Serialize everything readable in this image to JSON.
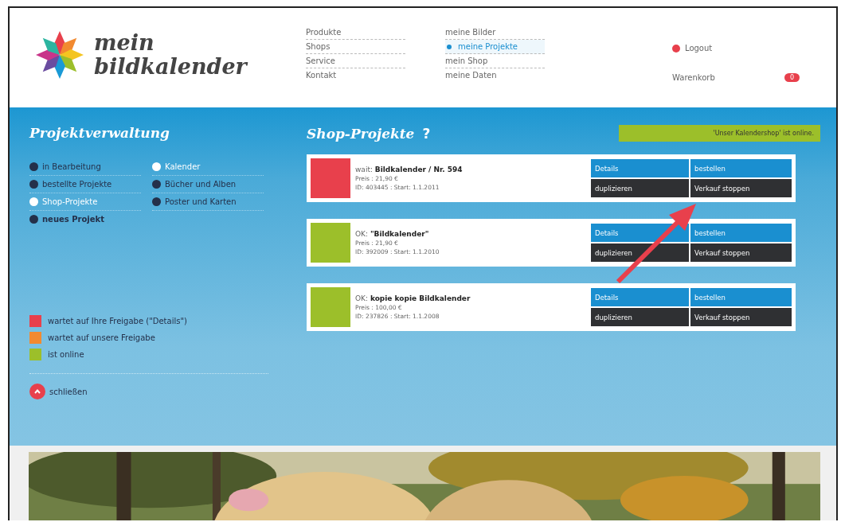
{
  "logo": {
    "line1": "mein",
    "line2": "bildkalender"
  },
  "nav": {
    "column_1": [
      {
        "label": "Produkte",
        "selected": false
      },
      {
        "label": "Shops",
        "selected": false
      },
      {
        "label": "Service",
        "selected": false
      },
      {
        "label": "Kontakt",
        "selected": false
      }
    ],
    "column_2": [
      {
        "label": "meine Bilder",
        "selected": false
      },
      {
        "label": "meine Projekte",
        "selected": true
      },
      {
        "label": "mein Shop",
        "selected": false
      },
      {
        "label": "meine Daten",
        "selected": false
      }
    ]
  },
  "account": {
    "logout": "Logout",
    "cart": "Warenkorb",
    "cart_count": "0"
  },
  "sidebar": {
    "title": "Projektverwaltung",
    "column_1": [
      {
        "label": "in Bearbeitung",
        "selected": false,
        "bold": false
      },
      {
        "label": "bestellte Projekte",
        "selected": false,
        "bold": false
      },
      {
        "label": "Shop-Projekte",
        "selected": true,
        "bold": false
      },
      {
        "label": "neues Projekt",
        "selected": false,
        "bold": true
      }
    ],
    "column_2": [
      {
        "label": "Kalender",
        "selected": true,
        "bold": false
      },
      {
        "label": "Bücher und Alben",
        "selected": false,
        "bold": false
      },
      {
        "label": "Poster und Karten",
        "selected": false,
        "bold": false
      }
    ],
    "legend": [
      {
        "label": "wartet auf Ihre Freigabe (\"Details\")",
        "color": "#e8404c"
      },
      {
        "label": "wartet auf unsere Freigabe",
        "color": "#f28a30"
      },
      {
        "label": "ist online",
        "color": "#9cbf2a"
      }
    ],
    "close": "schließen"
  },
  "main": {
    "title": "Shop-Projekte",
    "help": "?",
    "notice": "'Unser Kalendershop' ist online.",
    "projects": [
      {
        "status": "wait:",
        "name": "Bildkalender / Nr. 594",
        "price": "Preis : 21,90 €",
        "meta": "ID: 403445 : Start: 1.1.2011",
        "color": "#e8404c",
        "buttons": [
          "Details",
          "bestellen",
          "duplizieren",
          "Verkauf stoppen"
        ]
      },
      {
        "status": "OK:",
        "name": "\"Bildkalender\"",
        "price": "Preis : 21,90 €",
        "meta": "ID: 392009 : Start: 1.1.2010",
        "color": "#9cbf2a",
        "buttons": [
          "Details",
          "bestellen",
          "duplizieren",
          "Verkauf stoppen"
        ]
      },
      {
        "status": "OK:",
        "name": "kopie kopie Bildkalender",
        "price": "Preis : 100,00 €",
        "meta": "ID: 237826 : Start: 1.1.2008",
        "color": "#9cbf2a",
        "buttons": [
          "Details",
          "bestellen",
          "duplizieren",
          "Verkauf stoppen"
        ]
      }
    ]
  }
}
